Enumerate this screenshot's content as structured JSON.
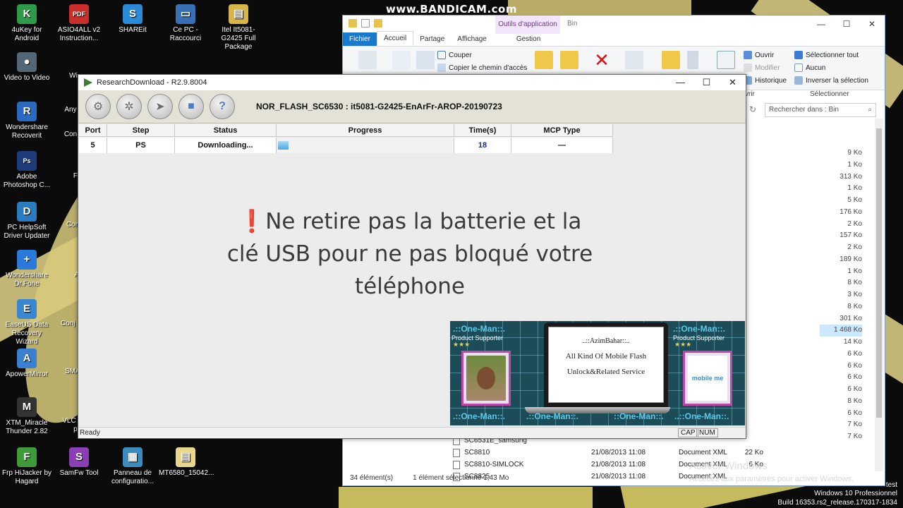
{
  "watermark": "www.BANDICAM.com",
  "desktop_icons": [
    {
      "label": "4uKey for Android",
      "icon": "android-key-icon",
      "color": "#2f9a4a",
      "glyph": "K"
    },
    {
      "label": "Video to Video",
      "icon": "film-reel-icon",
      "color": "#556677",
      "glyph": "●"
    },
    {
      "label": "Wondershare Recoverit",
      "icon": "recoverit-icon",
      "color": "#2a6bbf",
      "glyph": "R"
    },
    {
      "label": "Adobe Photoshop C...",
      "icon": "photoshop-icon",
      "color": "#1f3d7a",
      "glyph": "Ps"
    },
    {
      "label": "PC HelpSoft Driver Updater",
      "icon": "driver-updater-icon",
      "color": "#2a7bbf",
      "glyph": "D"
    },
    {
      "label": "Wondershare Dr.Fone",
      "icon": "drfone-icon",
      "color": "#2a7bd9",
      "glyph": "+"
    },
    {
      "label": "EaseUS Data Recovery Wizard",
      "icon": "easeus-icon",
      "color": "#3b86d1",
      "glyph": "E"
    },
    {
      "label": "ApowerMirror",
      "icon": "apowermirror-icon",
      "color": "#3b7fd1",
      "glyph": "A"
    },
    {
      "label": "XTM_Miracle Thunder 2.82",
      "icon": "miracle-thunder-icon",
      "color": "#333333",
      "glyph": "M"
    },
    {
      "label": "Frp HiJacker by Hagard",
      "icon": "frp-hijacker-icon",
      "color": "#3f9a3a",
      "glyph": "F"
    },
    {
      "label": "ASIO4ALL v2 Instruction...",
      "icon": "pdf-icon",
      "color": "#c9302c",
      "glyph": "PDF"
    },
    {
      "label": "SHAREit",
      "icon": "shareit-icon",
      "color": "#2a8bd9",
      "glyph": "S"
    },
    {
      "label": "Ce PC - Raccourci",
      "icon": "this-pc-icon",
      "color": "#3a6fb5",
      "glyph": "▭"
    },
    {
      "label": "Itel It5081-G2425 Full Package",
      "icon": "zip-folder-icon",
      "color": "#d8b548",
      "glyph": "▤"
    },
    {
      "label": "SamFw Tool",
      "icon": "samfw-icon",
      "color": "#8a3fb5",
      "glyph": "S"
    },
    {
      "label": "Panneau de configuratio...",
      "icon": "control-panel-icon",
      "color": "#3a8bbf",
      "glyph": "▦"
    },
    {
      "label": "MT6580_15042...",
      "icon": "document-icon",
      "color": "#e8d88a",
      "glyph": "▤"
    }
  ],
  "partial_icon_labels": [
    "Wi",
    "Any",
    "Con",
    "Fi",
    "Cor",
    "Al",
    "Conj",
    "SMA",
    "VLC",
    "pl"
  ],
  "explorer": {
    "context_tab": "Outils d'application",
    "context_group": "Gestion",
    "title": "Bin",
    "tabs": [
      "Fichier",
      "Accueil",
      "Partage",
      "Affichage"
    ],
    "ribbon": {
      "couper": "Couper",
      "copier_chemin": "Copier le chemin d'accès",
      "ouvrir": "Ouvrir",
      "modifier": "Modifier",
      "historique": "Historique",
      "selectionner_tout": "Sélectionner tout",
      "aucun": "Aucun",
      "inverser": "Inverser la sélection",
      "selectionner_group": "Sélectionner",
      "ouvrir_group": "vrir",
      "partial": [
        "Épingler dans",
        "Copier",
        "Coller",
        "Déplacer",
        "Copier",
        "Supprimer",
        "Renommer",
        "Nouveau",
        "Propriétés"
      ]
    },
    "search_placeholder": "Rechercher dans : Bin",
    "sizes": [
      "9 Ko",
      "1 Ko",
      "313 Ko",
      "1 Ko",
      "5 Ko",
      "176 Ko",
      "2 Ko",
      "157 Ko",
      "2 Ko",
      "189 Ko",
      "1 Ko",
      "8 Ko",
      "3 Ko",
      "8 Ko",
      "301 Ko",
      "1 468 Ko",
      "14 Ko",
      "6 Ko",
      "6 Ko",
      "6 Ko",
      "6 Ko",
      "8 Ko",
      "6 Ko",
      "7 Ko",
      "7 Ko"
    ],
    "rows": [
      {
        "name": "SC6531E_samsung",
        "date": "",
        "type": "",
        "size": ""
      },
      {
        "name": "SC8810",
        "date": "21/08/2013 11:08",
        "type": "Document XML",
        "size": "22 Ko"
      },
      {
        "name": "SC8810-SIMLOCK",
        "date": "21/08/2013 11:08",
        "type": "Document XML",
        "size": "6 Ko"
      },
      {
        "name": "SC8825",
        "date": "21/08/2013 11:08",
        "type": "Document XML",
        "size": ""
      }
    ],
    "status_count": "34 élément(s)",
    "status_selected": "1 élément sélectionné  1,43 Mo"
  },
  "activation": {
    "title": "Activer Windows",
    "subtitle": "Accédez aux paramètres pour activer Windows."
  },
  "taskinfo": {
    "line1": "test",
    "line2": "Windows 10 Professionnel",
    "line3": "Build 16353.rs2_release.170317-1834"
  },
  "research_download": {
    "title": "ResearchDownload - R2.9.8004",
    "firmware_label": "NOR_FLASH_SC6530 : it5081-G2425-EnArFr-AROP-20190723",
    "columns": [
      "Port",
      "Step",
      "Status",
      "Progress",
      "Time(s)",
      "MCP Type"
    ],
    "row": {
      "port": "5",
      "step": "PS",
      "status": "Downloading...",
      "progress": 0.06,
      "time": "18",
      "mcp": "—"
    },
    "status_ready": "Ready",
    "indicators": [
      "CAP",
      "NUM"
    ]
  },
  "overlay_message": {
    "bang": "❗",
    "text_line1": "Ne retire pas la batterie et la",
    "text_line2": "clé USB pour ne pas bloqué votre",
    "text_line3": "téléphone"
  },
  "banner": {
    "tag_left": ".::One-Man::.",
    "tag_right": ".::One-Man::.",
    "sub_left": "Product Supporter",
    "sub_right": "Product Supporter",
    "stars": "★★★",
    "bottom_tags": [
      ".::One-Man::.",
      ".::One-Man::.",
      "::One-Man::.",
      "..::One-Man::."
    ],
    "laptop_line1": "..::AzimBahar::..",
    "laptop_line2": "All Kind Of Mobile Flash",
    "laptop_line3": "Unlock&Related Service",
    "mobile_me": "mobile me"
  }
}
